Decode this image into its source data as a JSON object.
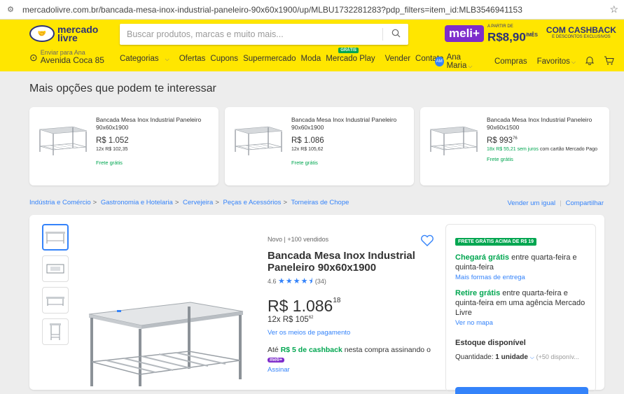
{
  "browser": {
    "url": "mercadolivre.com.br/bancada-mesa-inox-industrial-paneleiro-90x60x1900/up/MLBU1732281283?pdp_filters=item_id:MLB3546941153",
    "star_icon": "star-icon"
  },
  "header": {
    "logo_line1": "mercado",
    "logo_line2": "livre",
    "search_placeholder": "Buscar produtos, marcas e muito mais...",
    "promo": {
      "meli": "meli+",
      "from": "A PARTIR DE",
      "price": "R$8,90",
      "per": "/MÊS",
      "cashback": "COM CASHBACK",
      "cashback_sub": "E DESCONTOS EXCLUSIVOS"
    },
    "location": {
      "line1": "Enviar para Ana",
      "line2": "Avenida Coca 85"
    },
    "nav": [
      "Categorias",
      "Ofertas",
      "Cupons",
      "Supermercado",
      "Moda",
      "Mercado Play",
      "Vender",
      "Contato"
    ],
    "nav_badge": "GRÁTIS",
    "user": {
      "initials": "AM",
      "name": "Ana Maria",
      "purchases": "Compras",
      "favorites": "Favoritos"
    }
  },
  "more_options": {
    "title": "Mais opções que podem te interessar",
    "cards": [
      {
        "title": "Bancada Mesa Inox Industrial Paneleiro 90x60x1900",
        "price": "R$ 1.052",
        "cents": "",
        "installments": "12x R$ 102,35",
        "installments_extra": "",
        "shipping": "Frete grátis"
      },
      {
        "title": "Bancada Mesa Inox Industrial Paneleiro 90x60x1900",
        "price": "R$ 1.086",
        "cents": "",
        "installments": "12x R$ 105,62",
        "installments_extra": "",
        "shipping": "Frete grátis"
      },
      {
        "title": "Bancada Mesa Inox Industrial Paneleiro 90x60x1500",
        "price": "R$ 993",
        "cents": "76",
        "installments": "18x R$ 55,21 sem juros",
        "installments_extra": " com cartão Mercado Pago",
        "shipping": "Frete grátis"
      }
    ]
  },
  "breadcrumbs": [
    "Indústria e Comércio",
    "Gastronomia e Hotelaria",
    "Cervejeira",
    "Peças e Acessórios",
    "Torneiras de Chope"
  ],
  "seller_links": {
    "sell": "Vender um igual",
    "share": "Compartilhar"
  },
  "product": {
    "condition": "Novo | +100 vendidos",
    "title": "Bancada Mesa Inox Industrial Paneleiro 90x60x1900",
    "rating": "4.6",
    "reviews": "(34)",
    "stars": "★★★★⯨",
    "rating_value": 4.6,
    "price": "R$ 1.086",
    "cents": "18",
    "installments": "12x R$ 105",
    "installments_cents": "62",
    "payment_link": "Ver os meios de pagamento",
    "cashback_prefix": "Até ",
    "cashback_amount": "R$ 5 de cashback",
    "cashback_suffix": " nesta compra assinando o",
    "meli_tag": "meli+",
    "subscribe": "Assinar"
  },
  "sidebar": {
    "badge": "FRETE GRÁTIS ACIMA DE R$ 19",
    "arrival_bold": "Chegará grátis",
    "arrival_rest": " entre quarta-feira e quinta-feira",
    "delivery_link": "Mais formas de entrega",
    "pickup_bold": "Retire grátis",
    "pickup_rest": " entre quarta-feira e quinta-feira em uma agência Mercado Livre",
    "map_link": "Ver no mapa",
    "stock": "Estoque disponível",
    "qty_label": "Quantidade: ",
    "qty_value": "1 unidade",
    "qty_avail": "(+50 disponív..."
  },
  "colors": {
    "brand_yellow": "#ffe600",
    "link_blue": "#3483fa",
    "green": "#00a650",
    "meli_purple": "#7e2ccb"
  }
}
